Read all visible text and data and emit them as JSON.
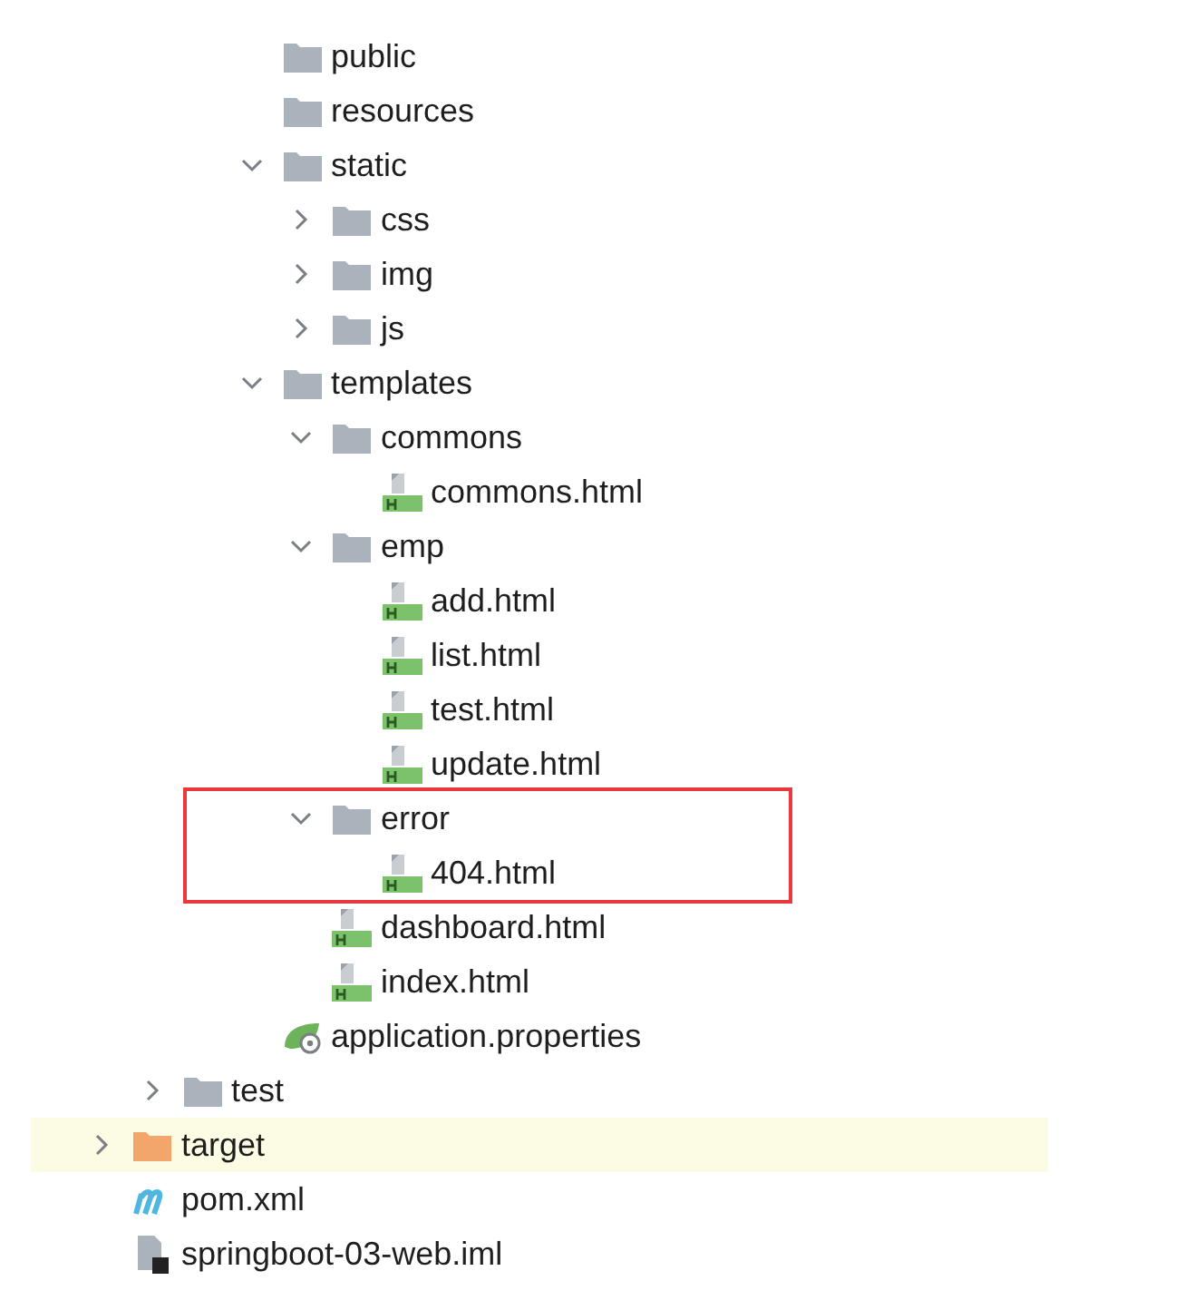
{
  "tree": [
    {
      "children": [
        {
          "children": [
            {
              "children": [
                {
                  "label": "public",
                  "kind": "folder",
                  "selected": false
                },
                {
                  "label": "resources",
                  "kind": "folder",
                  "selected": false
                },
                {
                  "label": "static",
                  "kind": "folder",
                  "expanded": true,
                  "selected": false,
                  "children": [
                    {
                      "label": "css",
                      "kind": "folder",
                      "expanded": false,
                      "selected": false
                    },
                    {
                      "label": "img",
                      "kind": "folder",
                      "expanded": false,
                      "selected": false
                    },
                    {
                      "label": "js",
                      "kind": "folder",
                      "expanded": false,
                      "selected": false
                    }
                  ]
                },
                {
                  "label": "templates",
                  "kind": "folder",
                  "expanded": true,
                  "selected": false,
                  "children": [
                    {
                      "label": "commons",
                      "kind": "folder",
                      "expanded": true,
                      "selected": false,
                      "children": [
                        {
                          "label": "commons.html",
                          "kind": "html",
                          "selected": false
                        }
                      ]
                    },
                    {
                      "label": "emp",
                      "kind": "folder",
                      "expanded": true,
                      "selected": false,
                      "children": [
                        {
                          "label": "add.html",
                          "kind": "html",
                          "selected": false
                        },
                        {
                          "label": "list.html",
                          "kind": "html",
                          "selected": false
                        },
                        {
                          "label": "test.html",
                          "kind": "html",
                          "selected": false
                        },
                        {
                          "label": "update.html",
                          "kind": "html",
                          "selected": false
                        }
                      ]
                    },
                    {
                      "label": "error",
                      "kind": "folder",
                      "expanded": true,
                      "selected": false,
                      "annotated": true,
                      "children": [
                        {
                          "label": "404.html",
                          "kind": "html",
                          "selected": false
                        }
                      ]
                    },
                    {
                      "label": "dashboard.html",
                      "kind": "html",
                      "selected": false
                    },
                    {
                      "label": "index.html",
                      "kind": "html",
                      "selected": false
                    }
                  ]
                },
                {
                  "label": "application.properties",
                  "kind": "properties",
                  "selected": false
                }
              ]
            }
          ]
        },
        {
          "label": "test",
          "kind": "folder",
          "expanded": false,
          "selected": false
        }
      ]
    },
    {
      "label": "target",
      "kind": "excluded-folder",
      "expanded": false,
      "selected": true
    },
    {
      "label": "pom.xml",
      "kind": "maven",
      "selected": false
    },
    {
      "label": "springboot-03-web.iml",
      "kind": "module",
      "selected": false
    }
  ]
}
